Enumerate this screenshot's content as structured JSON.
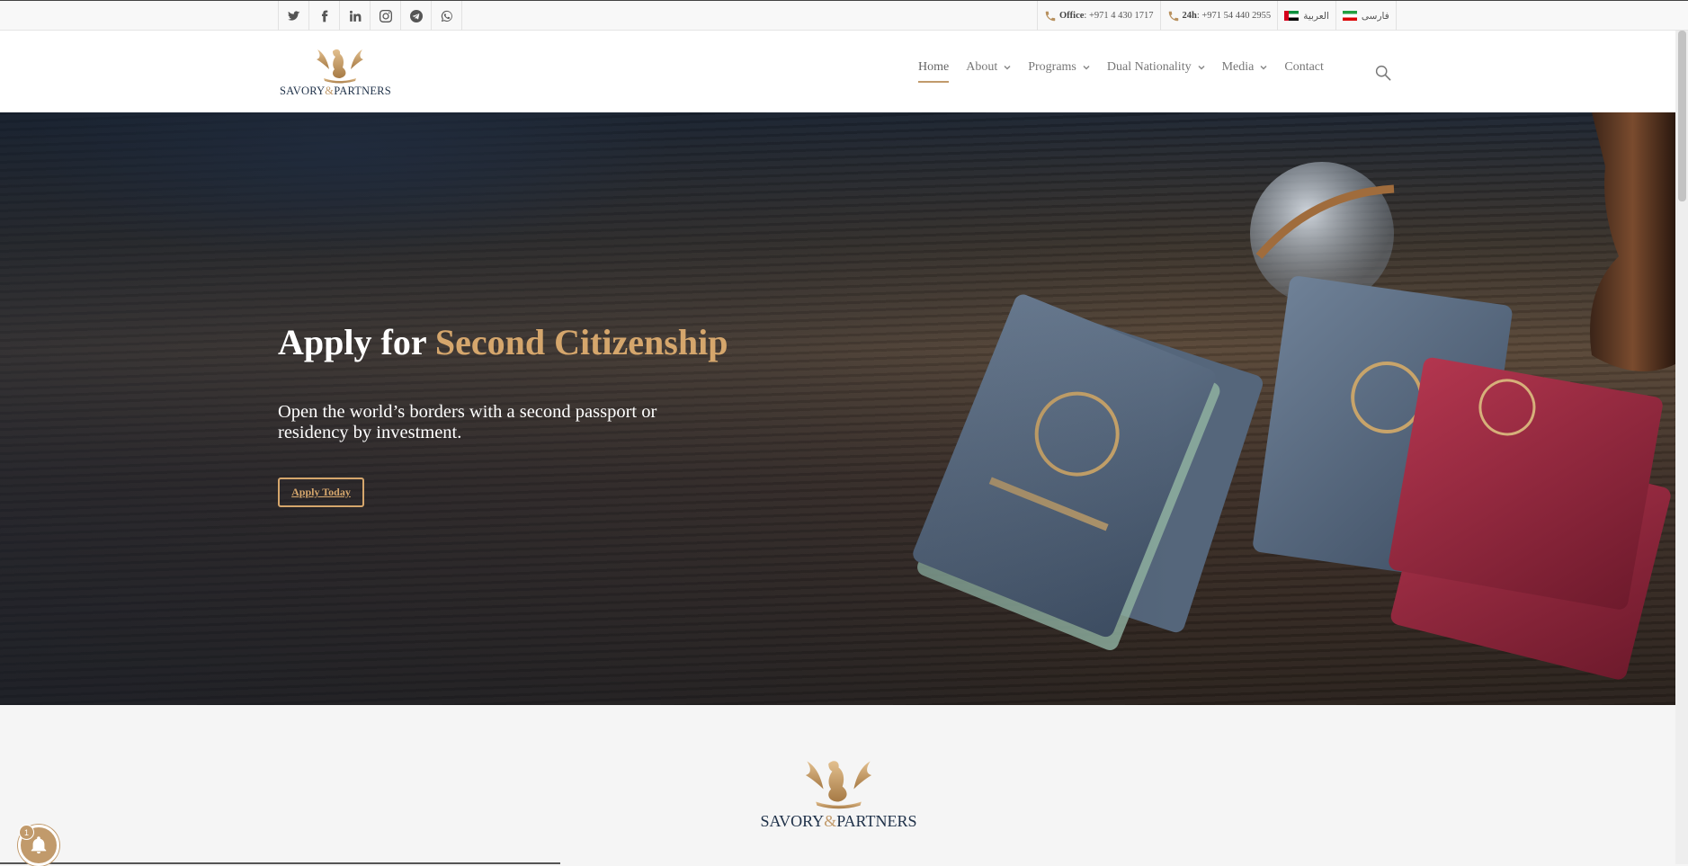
{
  "topbar": {
    "social": [
      {
        "name": "twitter-icon"
      },
      {
        "name": "facebook-icon"
      },
      {
        "name": "linkedin-icon"
      },
      {
        "name": "instagram-icon"
      },
      {
        "name": "telegram-icon"
      },
      {
        "name": "whatsapp-icon"
      }
    ],
    "office_label": "Office",
    "office_number": ": +971 4 430 1717",
    "hotline_label": "24h",
    "hotline_number": ": +971 54 440 2955",
    "lang_arabic": "العربية",
    "lang_farsi": "فارسی"
  },
  "header": {
    "logo_text_left": "SAVORY",
    "logo_amp": "&",
    "logo_text_right": "PARTNERS",
    "nav": {
      "home": "Home",
      "about": "About",
      "programs": "Programs",
      "dual_nationality": "Dual Nationality",
      "media": "Media",
      "contact": "Contact"
    },
    "search_icon": "search-icon"
  },
  "hero": {
    "title_prefix": "Apply for ",
    "title_accent": "Second Citizenship",
    "subtitle": "Open the world’s borders with a second passport or residency by investment.",
    "button_label": "Apply Today"
  },
  "lower": {
    "logo_text_left": "SAVORY",
    "logo_amp": "&",
    "logo_text_right": "PARTNERS"
  },
  "notification": {
    "count": "1",
    "icon": "bell-icon"
  },
  "colors": {
    "accent": "#c19a6b",
    "hero_accent": "#d5a66c",
    "navy": "#1e3048"
  }
}
